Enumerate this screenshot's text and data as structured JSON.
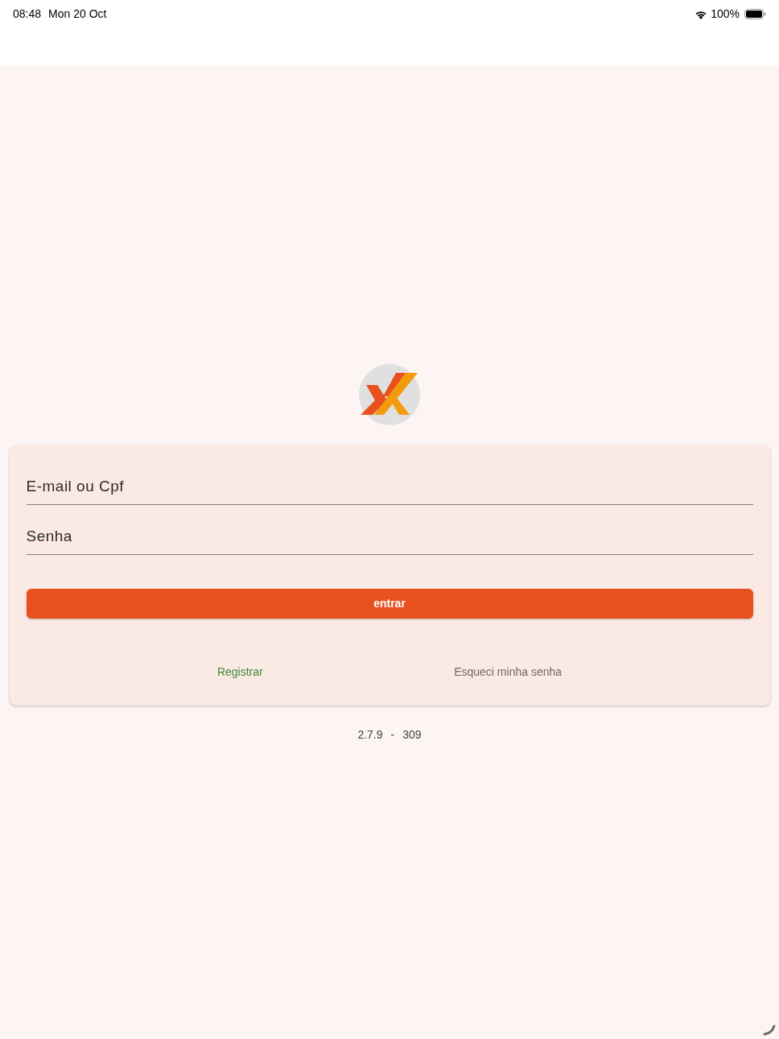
{
  "status_bar": {
    "time": "08:48",
    "date": "Mon 20 Oct",
    "battery": "100%"
  },
  "login_form": {
    "fields": [
      {
        "placeholder": "E-mail ou Cpf"
      },
      {
        "placeholder": "Senha"
      }
    ],
    "submit_button": "entrar",
    "links": [
      {
        "label": "Registrar",
        "color": "#3d8b3d"
      },
      {
        "label": "Esqueci minha senha",
        "color": "#6b6b6b"
      }
    ]
  },
  "version": {
    "number": "2.7.9",
    "separator": "-",
    "build": "309"
  }
}
